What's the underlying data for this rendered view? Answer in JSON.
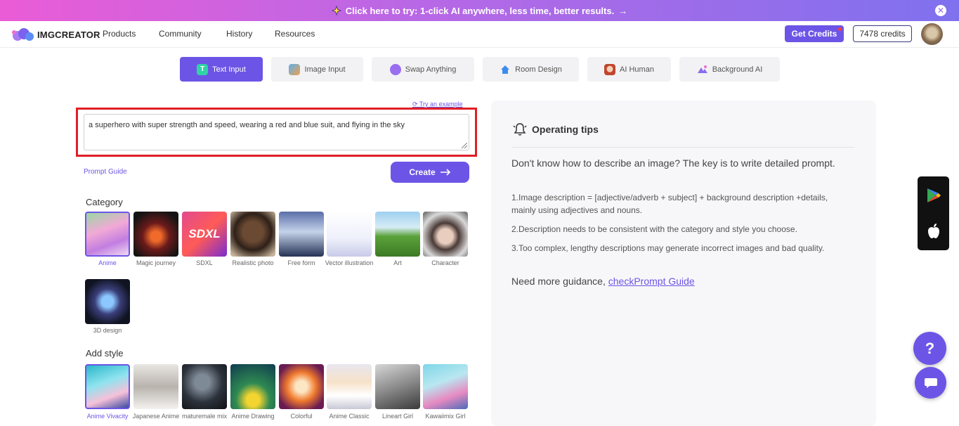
{
  "banner": {
    "text": "Click here to try: 1-click AI anywhere, less time, better results.",
    "arrow": "→",
    "close": "✕"
  },
  "nav": {
    "logo": "IMGCREATOR",
    "links": [
      "Products",
      "Community",
      "History",
      "Resources"
    ],
    "get_credits": "Get Credits",
    "credits": "7478 credits"
  },
  "tabs": [
    {
      "label": "Text Input",
      "icon": "text-icon",
      "active": true
    },
    {
      "label": "Image Input",
      "icon": "image-icon"
    },
    {
      "label": "Swap Anything",
      "icon": "swap-icon"
    },
    {
      "label": "Room Design",
      "icon": "house-icon"
    },
    {
      "label": "AI Human",
      "icon": "human-icon"
    },
    {
      "label": "Background AI",
      "icon": "background-icon"
    }
  ],
  "prompt": {
    "try_example": "Try an example",
    "text": "a superhero with super strength and speed, wearing a red and blue suit, and flying in the sky",
    "guide": "Prompt Guide",
    "create": "Create"
  },
  "category": {
    "title": "Category",
    "items": [
      {
        "label": "Anime",
        "selected": true
      },
      {
        "label": "Magic journey"
      },
      {
        "label": "SDXL"
      },
      {
        "label": "Realistic photo"
      },
      {
        "label": "Free form"
      },
      {
        "label": "Vector illustration"
      },
      {
        "label": "Art"
      },
      {
        "label": "Character"
      },
      {
        "label": "3D design"
      }
    ],
    "sdxl_text": "SDXL"
  },
  "style": {
    "title": "Add style",
    "items": [
      {
        "label": "Anime Vivacity",
        "selected": true
      },
      {
        "label": "Japanese Anime"
      },
      {
        "label": "maturemale mix"
      },
      {
        "label": "Anime Drawing"
      },
      {
        "label": "Colorful"
      },
      {
        "label": "Anime Classic"
      },
      {
        "label": "Lineart Girl"
      },
      {
        "label": "Kawaiimix Girl"
      }
    ]
  },
  "tips": {
    "title": "Operating tips",
    "intro": "Don't know how to describe an image? The key is to write detailed prompt.",
    "tip1": "1.Image description = [adjective/adverb + subject] + background description +details, mainly using adjectives and nouns.",
    "tip2": "2.Description needs to be consistent with the category and style you choose.",
    "tip3": "3.Too complex, lengthy descriptions may generate incorrect images and bad quality.",
    "more_prefix": "Need more guidance, ",
    "more_link": "checkPrompt Guide"
  },
  "help": "?",
  "colors": {
    "accent": "#6c55e6",
    "highlight": "#e01f26"
  }
}
